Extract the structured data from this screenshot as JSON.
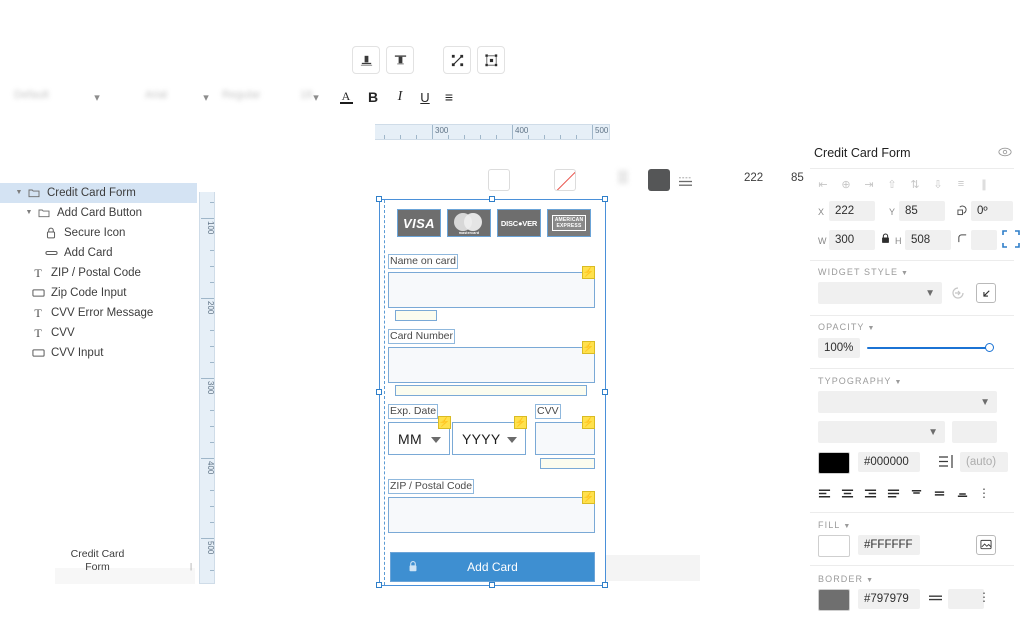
{
  "toolbar": {
    "buttons": [
      {
        "name": "align-bottom-button",
        "label": "Align Bottom"
      },
      {
        "name": "align-top-button",
        "label": "Align Top"
      },
      {
        "name": "resize-button",
        "label": "Resize"
      },
      {
        "name": "distribute-button",
        "label": "Distribute"
      }
    ],
    "font_family_default": "Default",
    "font_family": "Arial",
    "font_weight": "Regular",
    "font_size": "18",
    "text_color_label": "A",
    "bold_label": "B",
    "italic_label": "I",
    "underline_label": "U",
    "list_label": "≡",
    "x": "222",
    "y": "85",
    "w": "300",
    "h": "508"
  },
  "layers": {
    "items": [
      {
        "label": "Credit Card Form",
        "icon": "folder-icon",
        "indent": 0,
        "selected": true,
        "disclosure": true
      },
      {
        "label": "Add Card Button",
        "icon": "folder-icon",
        "indent": 1,
        "selected": false,
        "disclosure": true
      },
      {
        "label": "Secure Icon",
        "icon": "lock-icon",
        "indent": 2,
        "selected": false,
        "disclosure": false
      },
      {
        "label": "Add Card",
        "icon": "text-field-icon",
        "indent": 2,
        "selected": false,
        "disclosure": false
      },
      {
        "label": "ZIP / Postal Code",
        "icon": "text-icon",
        "indent": 1,
        "selected": false,
        "disclosure": false
      },
      {
        "label": "Zip Code Input",
        "icon": "input-icon",
        "indent": 1,
        "selected": false,
        "disclosure": false
      },
      {
        "label": "CVV Error Message",
        "icon": "text-icon",
        "indent": 1,
        "selected": false,
        "disclosure": false
      },
      {
        "label": "CVV",
        "icon": "text-icon",
        "indent": 1,
        "selected": false,
        "disclosure": false
      },
      {
        "label": "CVV Input",
        "icon": "input-icon",
        "indent": 1,
        "selected": false,
        "disclosure": false
      }
    ]
  },
  "rulers": {
    "horizontal": [
      "300",
      "400",
      "500"
    ],
    "vertical": [
      "100",
      "200",
      "300",
      "400",
      "500"
    ]
  },
  "canvas": {
    "artboard_label_line1": "Credit Card",
    "artboard_label_line2": "Form",
    "brands": [
      {
        "name": "visa-logo",
        "text": "VISA"
      },
      {
        "name": "mastercard-logo",
        "text": "mastercard"
      },
      {
        "name": "discover-logo",
        "text": "DISC●VER"
      },
      {
        "name": "amex-logo",
        "line1": "AMERICAN",
        "line2": "EXPRESS"
      }
    ],
    "fields": {
      "name_label": "Name on card",
      "card_number_label": "Card Number",
      "exp_date_label": "Exp. Date",
      "cvv_label": "CVV",
      "zip_label": "ZIP / Postal Code",
      "month_value": "MM",
      "year_value": "YYYY"
    },
    "submit_label": "Add Card",
    "badge_glyph": "⚡"
  },
  "properties": {
    "title": "Credit Card Form",
    "x_label": "X",
    "x_value": "222",
    "y_label": "Y",
    "y_value": "85",
    "rotation_value": "0º",
    "w_label": "W",
    "w_value": "300",
    "h_label": "H",
    "h_value": "508",
    "radius_value": "",
    "widget_style_section": "Widget Style",
    "widget_style_value": "",
    "opacity_section": "Opacity",
    "opacity_value": "100%",
    "typography_section": "Typography",
    "typography_font_value": "",
    "typography_weight_value": "",
    "typography_size_value": "",
    "text_color_hex": "#000000",
    "line_height_value": "(auto)",
    "fill_section": "Fill",
    "fill_hex": "#FFFFFF",
    "border_section": "Border",
    "border_hex": "#797979"
  },
  "colors": {
    "accent_blue": "#3e8fd1",
    "selection_blue": "#4a90d9",
    "layer_selected_bg": "#d4e3f3",
    "badge_yellow": "#ffe14d",
    "slider_blue": "#1b73d4",
    "text_color": "#000000",
    "fill_color": "#FFFFFF",
    "border_color": "#797979"
  }
}
